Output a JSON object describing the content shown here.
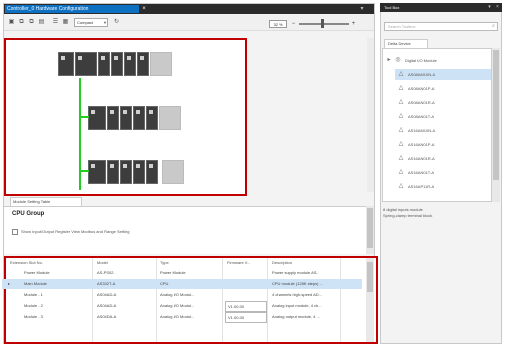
{
  "document_tab": {
    "title": "Controller_0 Hardware Configuration",
    "close": "×"
  },
  "toolbar": {
    "icons": [
      "▣",
      "⧉",
      "⧉",
      "▤"
    ],
    "dropdown_value": "Compact",
    "zoom_value": "32 %",
    "zoom_out": "−",
    "zoom_in": "+",
    "zoom_fraction": 0.44
  },
  "panel": {
    "tab_label": "Module Setting Table",
    "group_title": "CPU Group",
    "show_io_label": "Show Input/Output Register View Modbus and Range Setting"
  },
  "table": {
    "columns": [
      "Extension Slot No.",
      "Model",
      "Type",
      "Firmware V...",
      "Description",
      ""
    ],
    "rows": [
      [
        "",
        "Power Module",
        "AS-PS02",
        "Power Module",
        "",
        "Power supply module AS-"
      ],
      [
        "▸",
        "Main Module",
        "AS332T-A",
        "CPU",
        "",
        "CPU module (128K steps) ..."
      ],
      [
        "",
        "Module - 1",
        "AS04AD-A",
        "Analog I/O Modul...",
        "",
        "4 channels high-speed AD..."
      ],
      [
        "",
        "Module - 2",
        "AS04AD-A",
        "Analog I/O Modul...",
        "V1.00.00",
        "Analog input module, 4 ch..."
      ],
      [
        "",
        "Module - 3",
        "AS04DA-A",
        "Analog I/O Modul...",
        "V1.00.00",
        "Analog output module, 4 ..."
      ]
    ]
  },
  "toolbox": {
    "title": "Tool Box",
    "search_placeholder": "Search Toolbox",
    "tab_label": "Delta Device",
    "tree_root": "Digital I/O Module",
    "items": [
      "AS08AM10N-A",
      "AS08AN01P-A",
      "AS08AN01R-A",
      "AS08AN01T-A",
      "AS16AM10N-A",
      "AS16AN01P-A",
      "AS16AN01R-A",
      "AS16AN01T-A",
      "AS16AP11R-A"
    ],
    "description": "8 digital inputs module\nSpring-clamp terminal block"
  },
  "colors": {
    "accent": "#0e70c0",
    "highlight": "#c00000",
    "bus": "#22cc22"
  }
}
